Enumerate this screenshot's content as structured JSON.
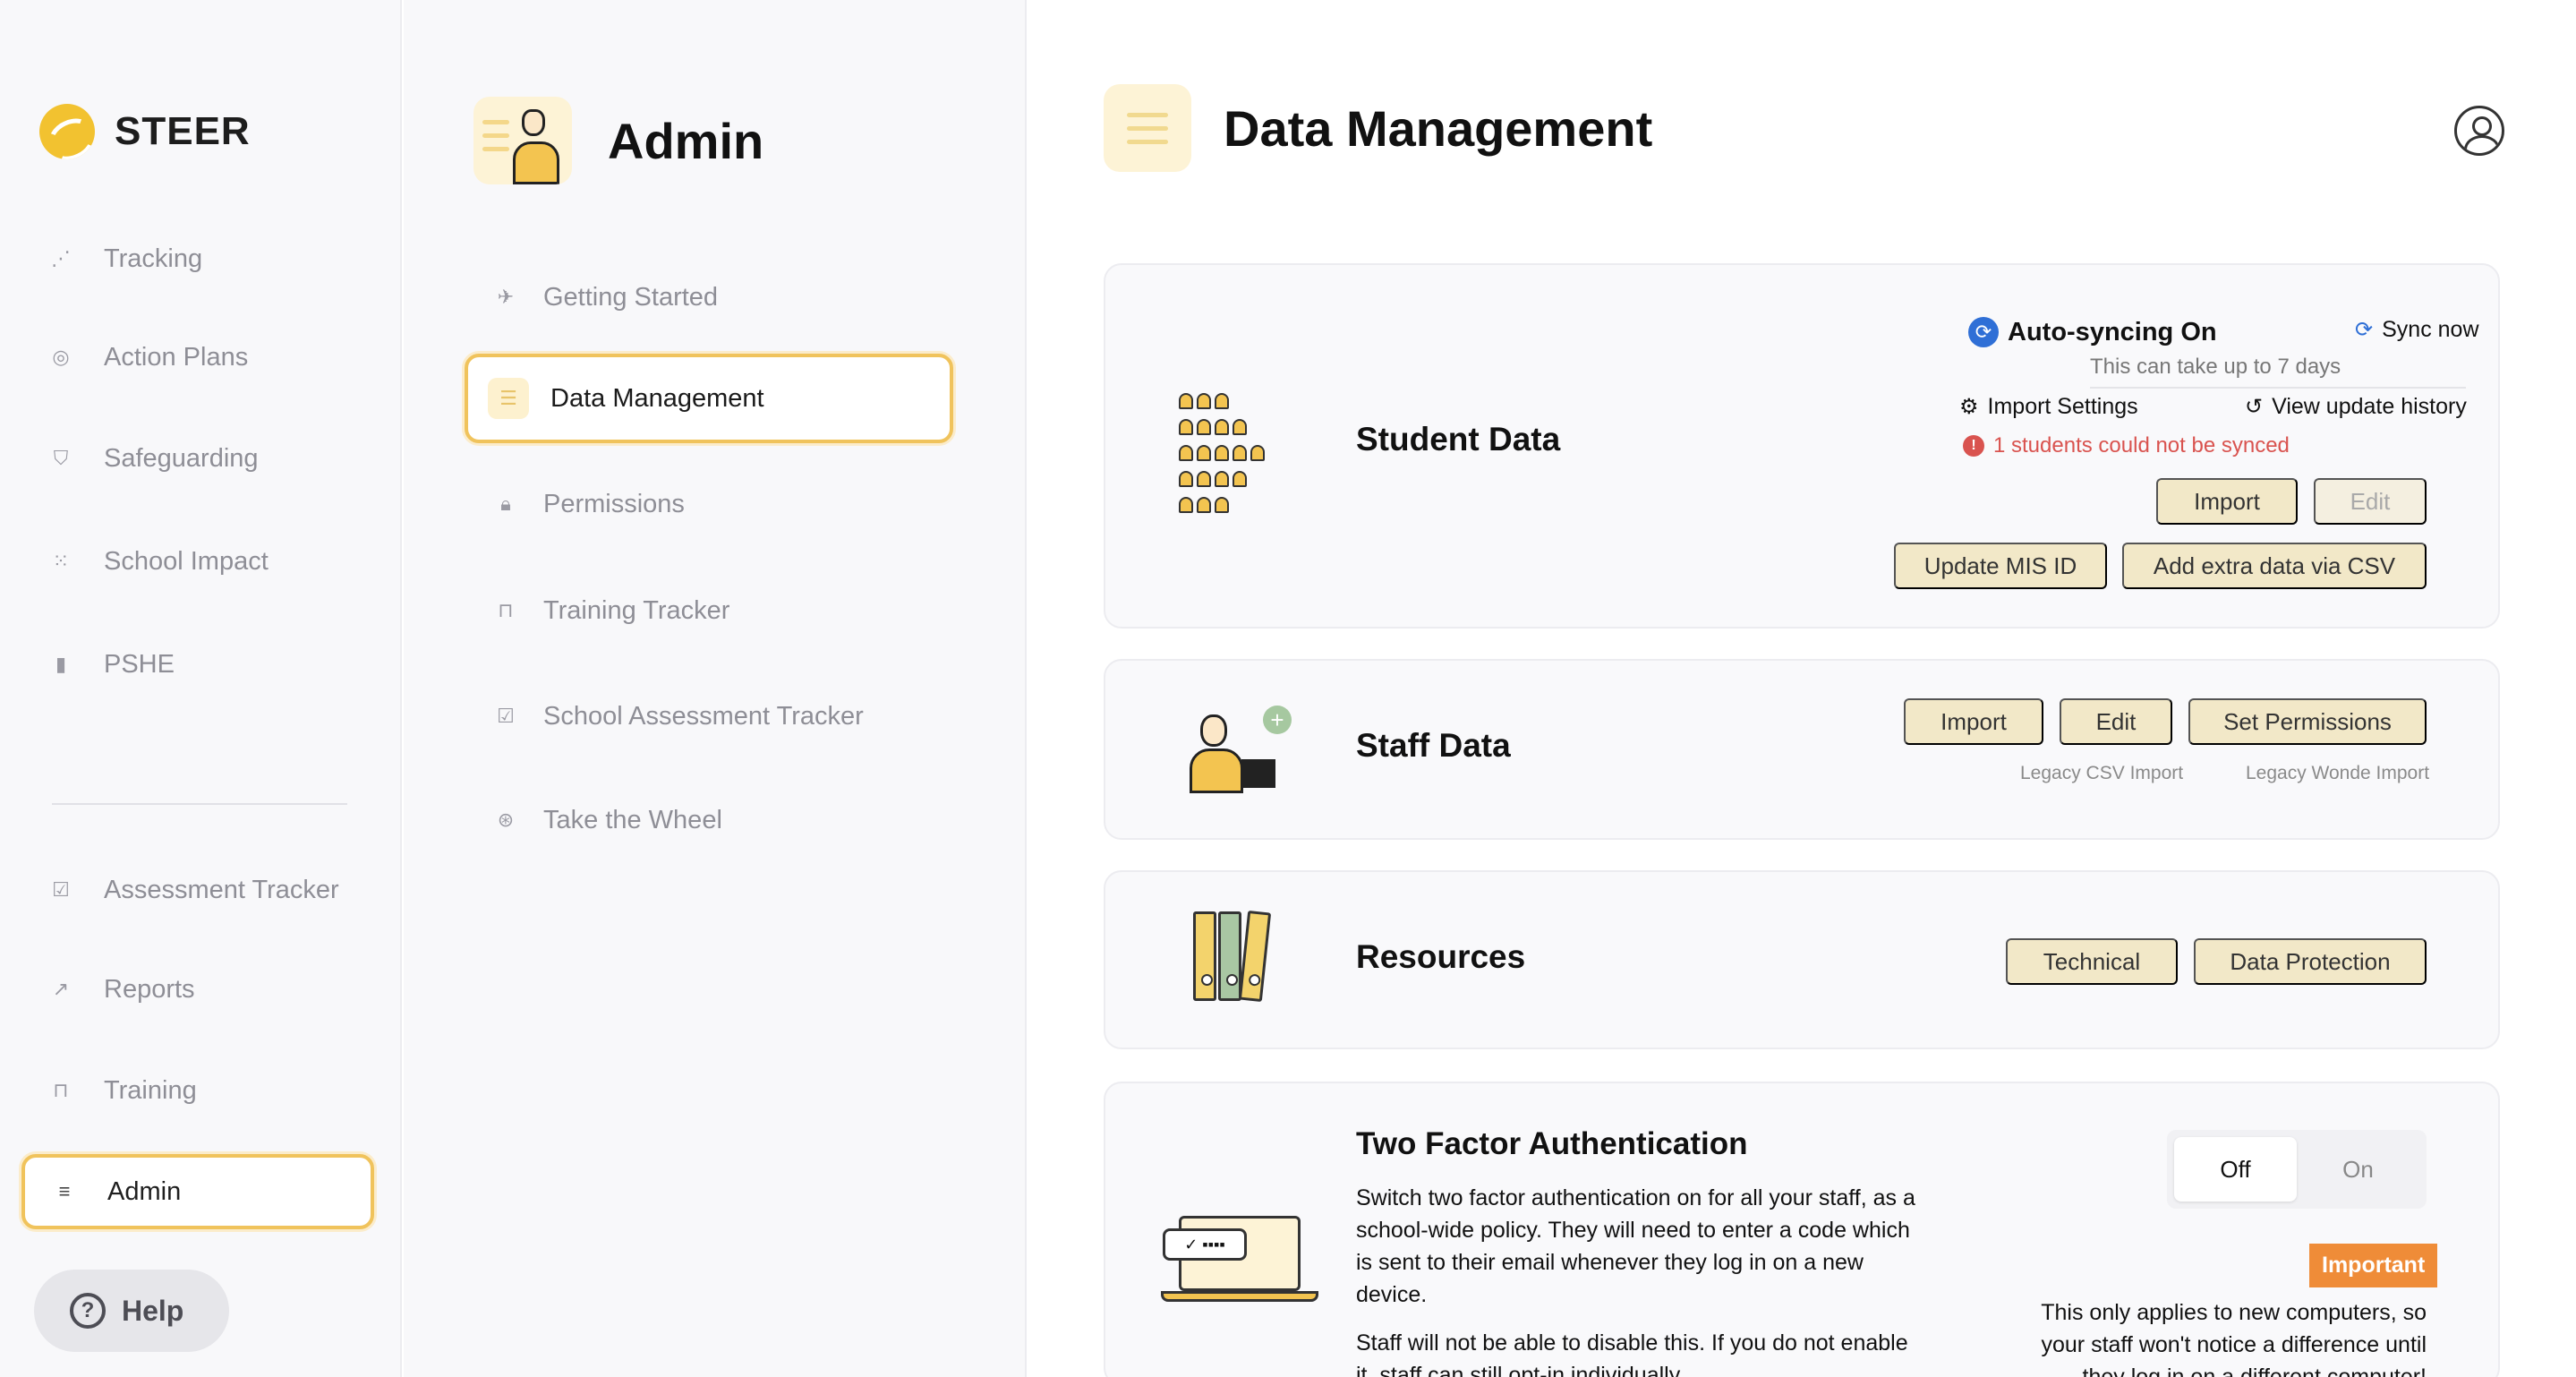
{
  "brand": {
    "name": "STEER"
  },
  "sidebar": {
    "items": [
      {
        "label": "Tracking"
      },
      {
        "label": "Action Plans"
      },
      {
        "label": "Safeguarding"
      },
      {
        "label": "School Impact"
      },
      {
        "label": "PSHE"
      },
      {
        "label": "Assessment Tracker"
      },
      {
        "label": "Reports"
      },
      {
        "label": "Training"
      },
      {
        "label": "Admin"
      }
    ],
    "help_label": "Help"
  },
  "subnav": {
    "title": "Admin",
    "items": [
      {
        "label": "Getting Started"
      },
      {
        "label": "Data Management"
      },
      {
        "label": "Permissions"
      },
      {
        "label": "Training Tracker"
      },
      {
        "label": "School Assessment Tracker"
      },
      {
        "label": "Take the Wheel"
      }
    ]
  },
  "page": {
    "title": "Data Management"
  },
  "student_data": {
    "title": "Student Data",
    "sync_status": "Auto-syncing On",
    "sync_now": "Sync now",
    "sync_note": "This can take up to 7 days",
    "import_settings": "Import Settings",
    "view_history": "View update history",
    "error": "1 students could not be synced",
    "import": "Import",
    "edit": "Edit",
    "update_mis": "Update MIS ID",
    "add_csv": "Add extra data via CSV"
  },
  "staff_data": {
    "title": "Staff Data",
    "import": "Import",
    "edit": "Edit",
    "set_permissions": "Set Permissions",
    "legacy_csv": "Legacy CSV Import",
    "legacy_wonde": "Legacy Wonde Import"
  },
  "resources": {
    "title": "Resources",
    "technical": "Technical",
    "data_protection": "Data Protection"
  },
  "two_fa": {
    "title": "Two Factor Authentication",
    "desc1": "Switch two factor authentication on for all your staff, as a school-wide policy. They will need to enter a code which is sent to their email whenever they log in on a new device.",
    "desc2": "Staff will not be able to disable this. If you do not enable it, staff can still opt-in individually.",
    "off": "Off",
    "on": "On",
    "important": "Important",
    "note": "This only applies to new computers, so your staff won't notice a difference until they log in on a different computer!"
  },
  "colors": {
    "accent": "#f0c35c",
    "button": "#f2e8c8",
    "error": "#d9534f",
    "important": "#ef8c38",
    "sync_blue": "#2f6fd6"
  }
}
